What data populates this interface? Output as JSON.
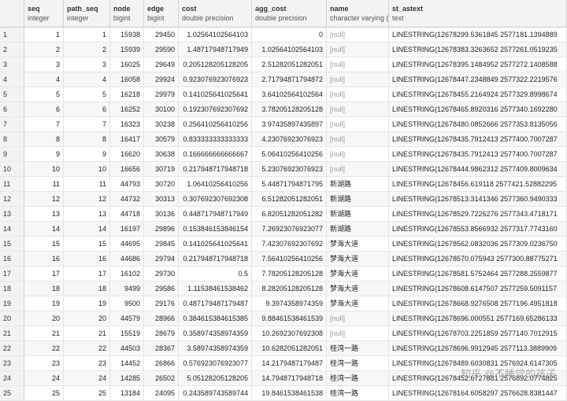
{
  "columns": [
    {
      "name": "",
      "type": ""
    },
    {
      "name": "seq",
      "type": "integer"
    },
    {
      "name": "path_seq",
      "type": "integer"
    },
    {
      "name": "node",
      "type": "bigint"
    },
    {
      "name": "edge",
      "type": "bigint"
    },
    {
      "name": "cost",
      "type": "double precision"
    },
    {
      "name": "agg_cost",
      "type": "double precision"
    },
    {
      "name": "name",
      "type": "character varying ("
    },
    {
      "name": "st_astext",
      "type": "text"
    }
  ],
  "rows": [
    [
      "1",
      "1",
      "1",
      "15938",
      "29450",
      "1.02564102564103",
      "0",
      "[null]",
      "LINESTRING(12678299.5361845 2577181.1394889"
    ],
    [
      "2",
      "2",
      "2",
      "15939",
      "29590",
      "1.48717948717949",
      "1.02564102564103",
      "[null]",
      "LINESTRING(12678383.3263652 2577261.0519235"
    ],
    [
      "3",
      "3",
      "3",
      "16025",
      "29649",
      "0.205128205128205",
      "2.51282051282051",
      "[null]",
      "LINESTRING(12678395.1484952 2577272.1408588"
    ],
    [
      "4",
      "4",
      "4",
      "16058",
      "29924",
      "0.923076923076923",
      "2.71794871794872",
      "[null]",
      "LINESTRING(12678447.2348849 2577322.2219576"
    ],
    [
      "5",
      "5",
      "5",
      "16218",
      "29979",
      "0.141025641025641",
      "3.64102564102564",
      "[null]",
      "LINESTRING(12678455.2164924 2577329.8998674"
    ],
    [
      "6",
      "6",
      "6",
      "16252",
      "30100",
      "0.192307692307692",
      "3.78205128205128",
      "[null]",
      "LINESTRING(12678465.8920316 2577340.1692280"
    ],
    [
      "7",
      "7",
      "7",
      "16323",
      "30238",
      "0.256410256410256",
      "3.97435897435897",
      "[null]",
      "LINESTRING(12678480.0852666 2577353.8135056"
    ],
    [
      "8",
      "8",
      "8",
      "16417",
      "30579",
      "0.833333333333333",
      "4.23076923076923",
      "[null]",
      "LINESTRING(12678435.7912413 2577400.7007287"
    ],
    [
      "9",
      "9",
      "9",
      "16620",
      "30638",
      "0.166666666666667",
      "5.06410256410256",
      "[null]",
      "LINESTRING(12678435.7912413 2577400.7007287"
    ],
    [
      "10",
      "10",
      "10",
      "16656",
      "30719",
      "0.217948717948718",
      "5.23076923076923",
      "[null]",
      "LINESTRING(12678444.9862312 2577409.8009634"
    ],
    [
      "11",
      "11",
      "11",
      "44793",
      "30720",
      "1.06410256410256",
      "5.44871794871795",
      "新湖路",
      "LINESTRING(12678456.619118 2577421.52882295"
    ],
    [
      "12",
      "12",
      "12",
      "44732",
      "30313",
      "0.307692307692308",
      "6.51282051282051",
      "新湖路",
      "LINESTRING(12678513.3141346 2577360.9490333"
    ],
    [
      "13",
      "13",
      "13",
      "44718",
      "30136",
      "0.448717948717949",
      "6.82051282051282",
      "新湖路",
      "LINESTRING(12678529.7226276 2577343.4718171"
    ],
    [
      "14",
      "14",
      "14",
      "16197",
      "29896",
      "0.153846153846154",
      "7.26923076923077",
      "新湖路",
      "LINESTRING(12678553.8566932 2577317.7743160"
    ],
    [
      "15",
      "15",
      "15",
      "44695",
      "29845",
      "0.141025641025641",
      "7.42307692307692",
      "梦海大道",
      "LINESTRING(12678562.0832036 2577309.0236750"
    ],
    [
      "16",
      "16",
      "16",
      "44686",
      "29794",
      "0.217948717948718",
      "7.56410256410256",
      "梦海大道",
      "LINESTRING(12678570.075943 2577300.88775271"
    ],
    [
      "17",
      "17",
      "17",
      "16102",
      "29730",
      "0.5",
      "7.78205128205128",
      "梦海大道",
      "LINESTRING(12678581.5752464 2577288.2559877"
    ],
    [
      "18",
      "18",
      "18",
      "9499",
      "29586",
      "1.11538461538462",
      "8.28205128205128",
      "梦海大道",
      "LINESTRING(12678608.6147507 2577259.5091157"
    ],
    [
      "19",
      "19",
      "19",
      "9500",
      "29176",
      "0.487179487179487",
      "9.3974358974359",
      "梦海大道",
      "LINESTRING(12678668.9276508 2577196.4951818"
    ],
    [
      "20",
      "20",
      "20",
      "44579",
      "28966",
      "0.384615384615385",
      "9.88461538461539",
      "[null]",
      "LINESTRING(12678696.000551 2577169.65286133"
    ],
    [
      "21",
      "21",
      "21",
      "15519",
      "28679",
      "0.358974358974359",
      "10.2692307692308",
      "[null]",
      "LINESTRING(12678703.2251859 2577140.7012915"
    ],
    [
      "22",
      "22",
      "22",
      "44503",
      "28367",
      "3.58974358974359",
      "10.6282051282051",
      "桂湾一路",
      "LINESTRING(12678696.9912945 2577113.3889909"
    ],
    [
      "23",
      "23",
      "23",
      "14452",
      "26866",
      "0.576923076923077",
      "14.2179487179487",
      "桂湾一路",
      "LINESTRING(12678489.6030831 2576924.6147305"
    ],
    [
      "24",
      "24",
      "24",
      "14285",
      "26502",
      "5.05128205128205",
      "14.7948717948718",
      "桂湾一路",
      "LINESTRING(12678452.6727881 2576892.0774825"
    ],
    [
      "25",
      "25",
      "25",
      "13184",
      "24095",
      "0.243589743589744",
      "19.8461538461538",
      "桂湾一路",
      "LINESTRING(12678164.6058297 2576628.8381447"
    ]
  ],
  "watermark": "知乎 @不睡觉的孩子"
}
